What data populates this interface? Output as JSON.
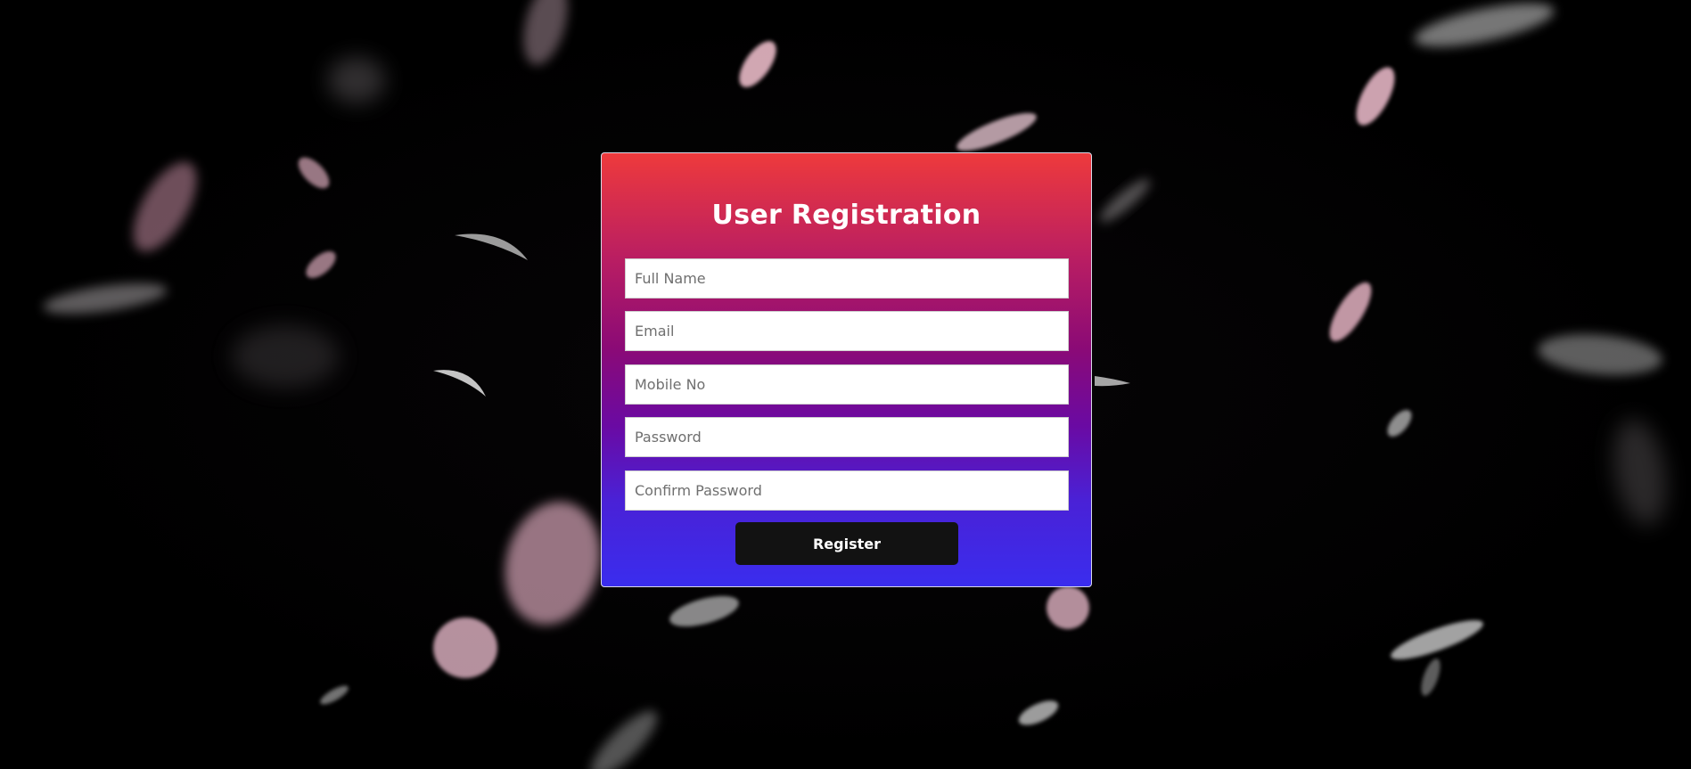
{
  "form": {
    "title": "User Registration",
    "fields": [
      {
        "placeholder": "Full Name",
        "value": ""
      },
      {
        "placeholder": "Email",
        "value": ""
      },
      {
        "placeholder": "Mobile No",
        "value": ""
      },
      {
        "placeholder": "Password",
        "value": ""
      },
      {
        "placeholder": "Confirm Password",
        "value": ""
      }
    ],
    "submit_label": "Register"
  },
  "colors": {
    "gradient_top": "#ee3a3c",
    "gradient_middle": "#8b0a76",
    "gradient_bottom": "#3a2dee",
    "button_background": "#121212",
    "page_background": "#000000",
    "petal_color": "#e6b8c8"
  }
}
